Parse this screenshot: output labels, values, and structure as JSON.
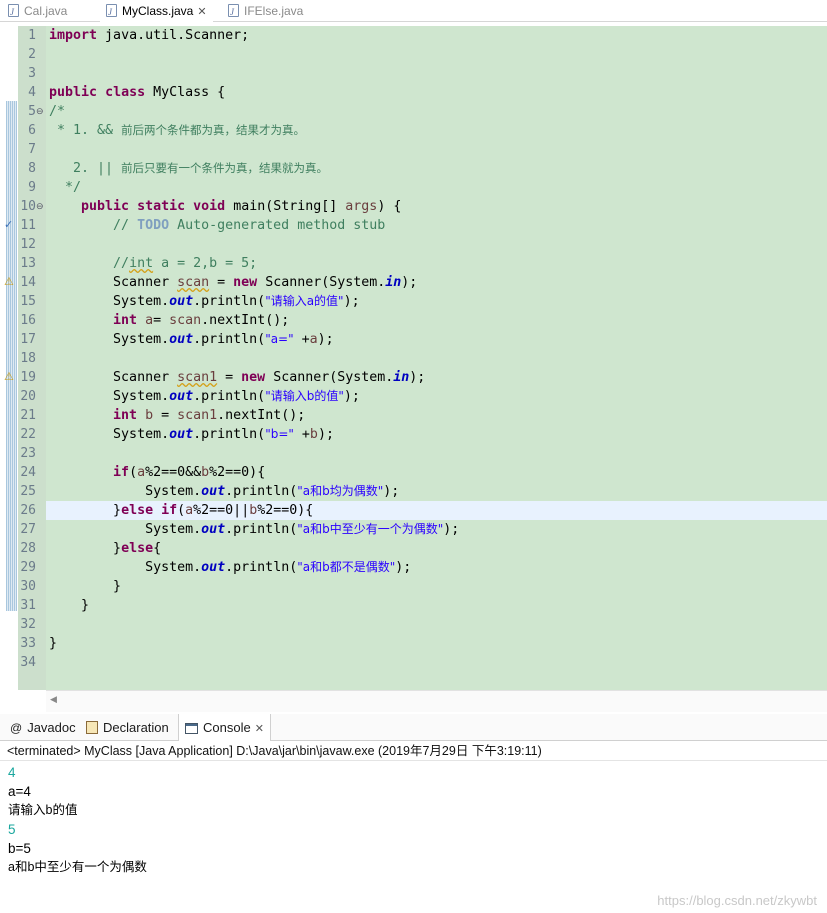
{
  "editor_tabs": [
    {
      "label": "Cal.java",
      "active": false
    },
    {
      "label": "MyClass.java",
      "active": true,
      "close": "✕"
    },
    {
      "label": "IFElse.java",
      "active": false
    }
  ],
  "icons": {
    "java_file": "java-file-icon",
    "fold_collapse": "collapse-icon",
    "warning": "warning-icon",
    "task": "task-icon",
    "scroll_left": "scroll-left-icon",
    "javadoc": "at-sign-icon",
    "declaration": "declaration-icon",
    "console": "console-icon"
  },
  "code": {
    "line_numbers": [
      "1",
      "2",
      "3",
      "4",
      "5",
      "6",
      "7",
      "8",
      "9",
      "10",
      "11",
      "12",
      "13",
      "14",
      "15",
      "16",
      "17",
      "18",
      "19",
      "20",
      "21",
      "22",
      "23",
      "24",
      "25",
      "26",
      "27",
      "28",
      "29",
      "30",
      "31",
      "32",
      "33",
      "34"
    ],
    "l1_kw": "import",
    "l1_rest": " java.util.Scanner;",
    "l4_kw1": "public",
    "l4_kw2": "class",
    "l4_rest": " MyClass {",
    "l5": "/*",
    "l6_a": " * 1. && ",
    "l6_b": "前后两个条件都为真，结果才为真。",
    "l8_a": "   2. || ",
    "l8_b": "前后只要有一个条件为真，结果就为真。",
    "l9": "  */",
    "l10_kw1": "public",
    "l10_kw2": "static",
    "l10_kw3": "void",
    "l10_rest1": " main(String[] ",
    "l10_var": "args",
    "l10_rest2": ") {",
    "l11_a": "// ",
    "l11_todo": "TODO",
    "l11_b": " Auto-generated method stub",
    "l13_a": "//",
    "l13_b": "int",
    "l13_c": " a = 2,b = 5;",
    "l14_a": "Scanner ",
    "l14_var": "scan",
    "l14_b": " = ",
    "l14_kw": "new",
    "l14_c": " Scanner(System.",
    "l14_fld": "in",
    "l14_d": ");",
    "l15_a": "System.",
    "l15_fld": "out",
    "l15_b": ".println(",
    "l15_str": "\"请输入a的值\"",
    "l15_c": ");",
    "l16_kw": "int",
    "l16_a": " ",
    "l16_var1": "a",
    "l16_b": "= ",
    "l16_var2": "scan",
    "l16_c": ".nextInt();",
    "l17_a": "System.",
    "l17_fld": "out",
    "l17_b": ".println(",
    "l17_str": "\"a=\"",
    "l17_c": " +",
    "l17_var": "a",
    "l17_d": ");",
    "l19_a": "Scanner ",
    "l19_var": "scan1",
    "l19_b": " = ",
    "l19_kw": "new",
    "l19_c": " Scanner(System.",
    "l19_fld": "in",
    "l19_d": ");",
    "l20_a": "System.",
    "l20_fld": "out",
    "l20_b": ".println(",
    "l20_str": "\"请输入b的值\"",
    "l20_c": ");",
    "l21_kw": "int",
    "l21_a": " ",
    "l21_var1": "b",
    "l21_b": " = ",
    "l21_var2": "scan1",
    "l21_c": ".nextInt();",
    "l22_a": "System.",
    "l22_fld": "out",
    "l22_b": ".println(",
    "l22_str": "\"b=\"",
    "l22_c": " +",
    "l22_var": "b",
    "l22_d": ");",
    "l24_kw": "if",
    "l24_a": "(",
    "l24_v1": "a",
    "l24_b": "%2==0&&",
    "l24_v2": "b",
    "l24_c": "%2==0){",
    "l25_a": "System.",
    "l25_fld": "out",
    "l25_b": ".println(",
    "l25_str": "\"a和b均为偶数\"",
    "l25_c": ");",
    "l26_a": "}",
    "l26_kw1": "else",
    "l26_b": " ",
    "l26_kw2": "if",
    "l26_c": "(",
    "l26_v1": "a",
    "l26_d": "%2==0||",
    "l26_v2": "b",
    "l26_e": "%2==0){",
    "l27_a": "System.",
    "l27_fld": "out",
    "l27_b": ".println(",
    "l27_str": "\"a和b中至少有一个为偶数\"",
    "l27_c": ");",
    "l28_a": "}",
    "l28_kw": "else",
    "l28_b": "{",
    "l29_a": "System.",
    "l29_fld": "out",
    "l29_b": ".println(",
    "l29_str": "\"a和b都不是偶数\"",
    "l29_c": ");",
    "l30": "}",
    "l31": "}",
    "l33": "}"
  },
  "views": {
    "tabs": [
      {
        "label": "Javadoc"
      },
      {
        "label": "Declaration"
      },
      {
        "label": "Console",
        "close": "✕"
      }
    ],
    "status": "<terminated> MyClass [Java Application] D:\\Java\\jar\\bin\\javaw.exe (2019年7月29日 下午3:19:11)",
    "output": [
      "4",
      "a=4",
      "请输入b的值",
      "5",
      "b=5",
      "a和b中至少有一个为偶数"
    ],
    "input_color": "#1aa79e"
  },
  "watermark": "https://blog.csdn.net/zkywbt",
  "colors": {
    "editor_bg": "#cfe6cf",
    "keyword": "#7f0055",
    "comment": "#3f7f5f",
    "string": "#2a00ff",
    "field": "#0000c0",
    "current_line": "#e8f2fe"
  }
}
